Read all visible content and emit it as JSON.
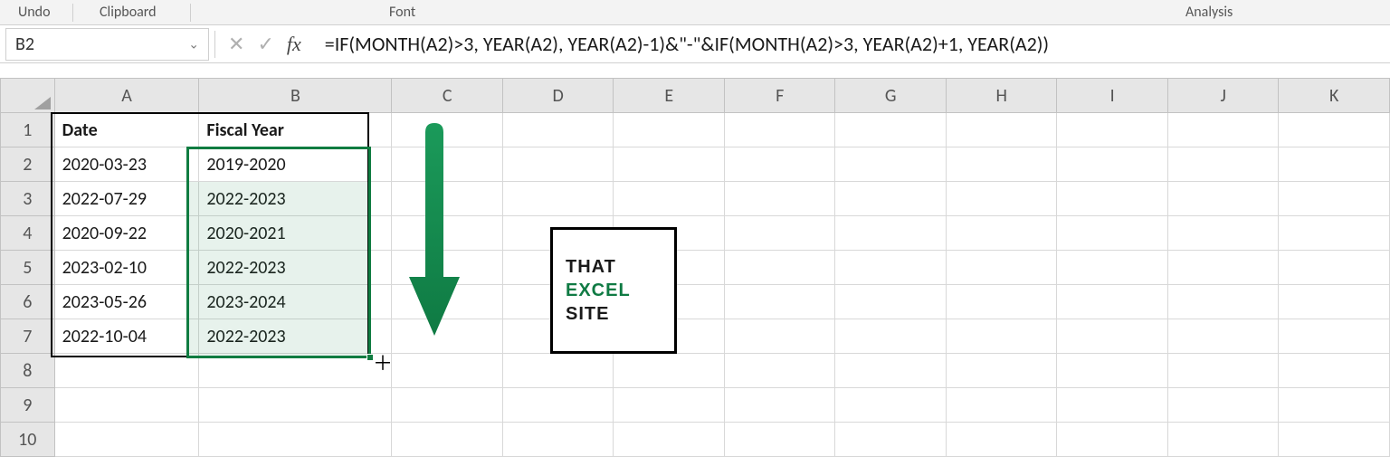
{
  "ribbon": {
    "undo": "Undo",
    "clipboard": "Clipboard",
    "font": "Font",
    "analysis": "Analysis"
  },
  "name_box": "B2",
  "formula": "=IF(MONTH(A2)>3, YEAR(A2), YEAR(A2)-1)&\"-\"&IF(MONTH(A2)>3, YEAR(A2)+1, YEAR(A2))",
  "columns": [
    "A",
    "B",
    "C",
    "D",
    "E",
    "F",
    "G",
    "H",
    "I",
    "J",
    "K"
  ],
  "row_numbers": [
    "1",
    "2",
    "3",
    "4",
    "5",
    "6",
    "7",
    "8",
    "9",
    "10"
  ],
  "headers": {
    "A": "Date",
    "B": "Fiscal Year"
  },
  "data": [
    {
      "A": "2020-03-23",
      "B": "2019-2020"
    },
    {
      "A": "2022-07-29",
      "B": "2022-2023"
    },
    {
      "A": "2020-09-22",
      "B": "2020-2021"
    },
    {
      "A": "2023-02-10",
      "B": "2022-2023"
    },
    {
      "A": "2023-05-26",
      "B": "2023-2024"
    },
    {
      "A": "2022-10-04",
      "B": "2022-2023"
    }
  ],
  "logo": {
    "line1": "THAT",
    "line2": "EXCEL",
    "line3": "SITE"
  },
  "colors": {
    "excel_green": "#107c41"
  },
  "icons": {
    "dropdown": "⌄",
    "cancel": "✕",
    "enter": "✓",
    "fx": "fx",
    "drag": "＋"
  }
}
